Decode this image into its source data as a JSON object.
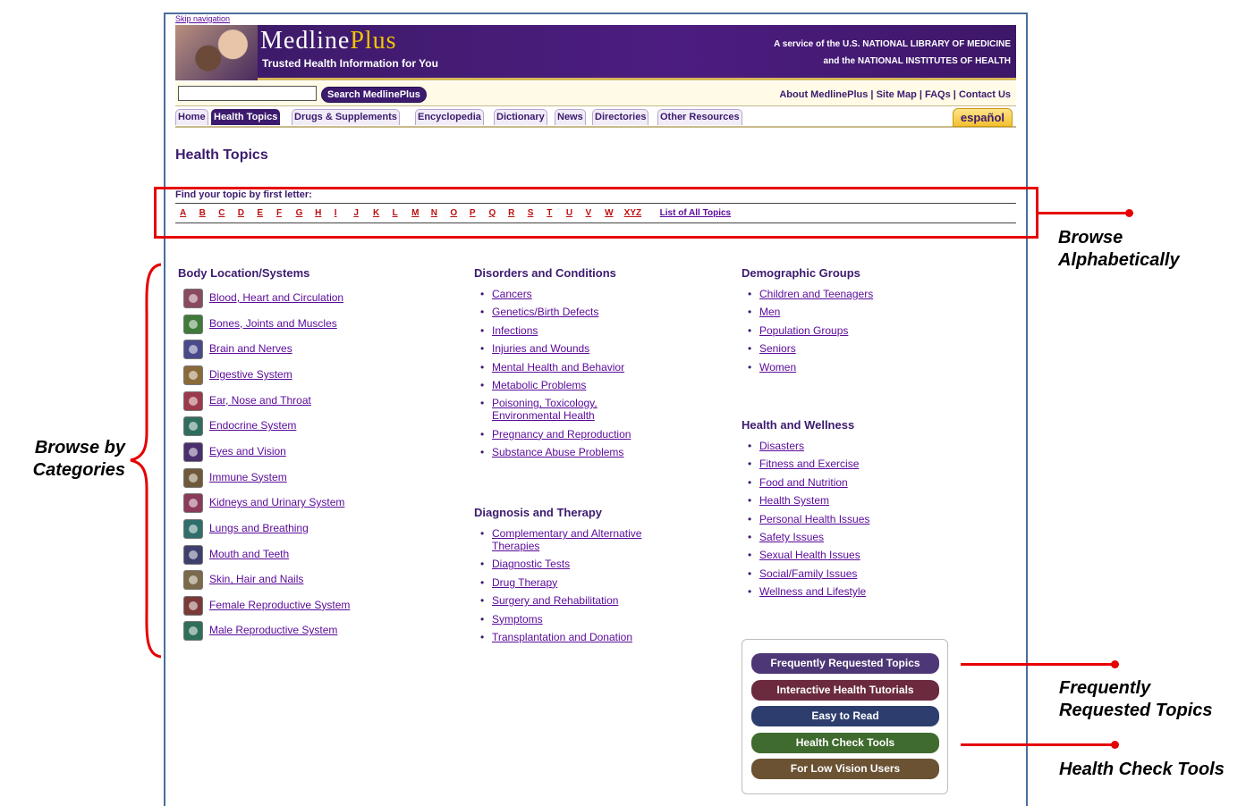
{
  "header": {
    "skip_nav": "Skip navigation",
    "logo_main": "Medline",
    "logo_plus": "Plus",
    "tagline": "Trusted Health Information for You",
    "service_line1": "A service of the U.S. NATIONAL LIBRARY OF MEDICINE",
    "service_line2": "and the NATIONAL INSTITUTES OF HEALTH"
  },
  "search": {
    "value": "",
    "button_label": "Search MedlinePlus"
  },
  "toplinks": [
    "About MedlinePlus",
    "Site Map",
    "FAQs",
    "Contact Us"
  ],
  "tabs": [
    "Home",
    "Health Topics",
    "Drugs & Supplements",
    "Encyclopedia",
    "Dictionary",
    "News",
    "Directories",
    "Other Resources"
  ],
  "active_tab": "Health Topics",
  "espanol": "español",
  "page_title": "Health Topics",
  "alphabet": {
    "label": "Find your topic by first letter:",
    "letters": [
      "A",
      "B",
      "C",
      "D",
      "E",
      "F",
      "G",
      "H",
      "I",
      "J",
      "K",
      "L",
      "M",
      "N",
      "O",
      "P",
      "Q",
      "R",
      "S",
      "T",
      "U",
      "V",
      "W",
      "XYZ"
    ],
    "all_topics": "List of All Topics"
  },
  "body_location": {
    "heading": "Body Location/Systems",
    "items": [
      {
        "label": "Blood, Heart and Circulation",
        "icon": "heart-icon",
        "color": "#8a4b5e"
      },
      {
        "label": "Bones, Joints and Muscles",
        "icon": "bone-icon",
        "color": "#3f7a3a"
      },
      {
        "label": "Brain and Nerves",
        "icon": "brain-icon",
        "color": "#4a4a8a"
      },
      {
        "label": "Digestive System",
        "icon": "stomach-icon",
        "color": "#8a6a3a"
      },
      {
        "label": "Ear, Nose and Throat",
        "icon": "ear-icon",
        "color": "#9a3a4a"
      },
      {
        "label": "Endocrine System",
        "icon": "gland-icon",
        "color": "#2f6e5e"
      },
      {
        "label": "Eyes and Vision",
        "icon": "eye-icon",
        "color": "#4a2f6e"
      },
      {
        "label": "Immune System",
        "icon": "cell-icon",
        "color": "#6e5a3a"
      },
      {
        "label": "Kidneys and Urinary System",
        "icon": "kidney-icon",
        "color": "#8a3a5a"
      },
      {
        "label": "Lungs and Breathing",
        "icon": "lungs-icon",
        "color": "#2f6e6a"
      },
      {
        "label": "Mouth and Teeth",
        "icon": "mouth-icon",
        "color": "#3f3f6e"
      },
      {
        "label": "Skin, Hair and Nails",
        "icon": "feather-icon",
        "color": "#7a6a4a"
      },
      {
        "label": "Female Reproductive System",
        "icon": "female-icon",
        "color": "#7a3a3a"
      },
      {
        "label": "Male Reproductive System",
        "icon": "male-icon",
        "color": "#2f6e5a"
      }
    ]
  },
  "disorders": {
    "heading": "Disorders and Conditions",
    "items": [
      "Cancers",
      "Genetics/Birth Defects",
      "Infections",
      "Injuries and Wounds",
      "Mental Health and Behavior",
      "Metabolic Problems",
      "Poisoning, Toxicology, Environmental Health",
      "Pregnancy and Reproduction",
      "Substance Abuse Problems"
    ]
  },
  "diagnosis": {
    "heading": "Diagnosis and Therapy",
    "items": [
      "Complementary and Alternative Therapies",
      "Diagnostic Tests",
      "Drug Therapy",
      "Surgery and Rehabilitation",
      "Symptoms",
      "Transplantation and Donation"
    ]
  },
  "demographic": {
    "heading": "Demographic Groups",
    "items": [
      "Children and Teenagers",
      "Men",
      "Population Groups",
      "Seniors",
      "Women"
    ]
  },
  "wellness": {
    "heading": "Health and Wellness",
    "items": [
      "Disasters",
      "Fitness and Exercise",
      "Food and Nutrition",
      "Health System",
      "Personal Health Issues",
      "Safety Issues",
      "Sexual Health Issues",
      "Social/Family Issues",
      "Wellness and Lifestyle"
    ]
  },
  "panel_buttons": [
    {
      "label": "Frequently Requested Topics",
      "color": "#4e3777"
    },
    {
      "label": "Interactive Health Tutorials",
      "color": "#6b2a3e"
    },
    {
      "label": "Easy to Read",
      "color": "#2d3e6e"
    },
    {
      "label": "Health Check Tools",
      "color": "#3f6b2e"
    },
    {
      "label": "For Low Vision Users",
      "color": "#6b5233"
    }
  ],
  "annotations": {
    "browse_alpha": "Browse Alphabetically",
    "browse_categories": "Browse by Categories",
    "frequently_requested": "Frequently Requested Topics",
    "health_check": "Health Check Tools"
  },
  "colors": {
    "brand_purple": "#3c1b6e",
    "annotation_red": "#e60000",
    "link": "#5a0a99"
  }
}
